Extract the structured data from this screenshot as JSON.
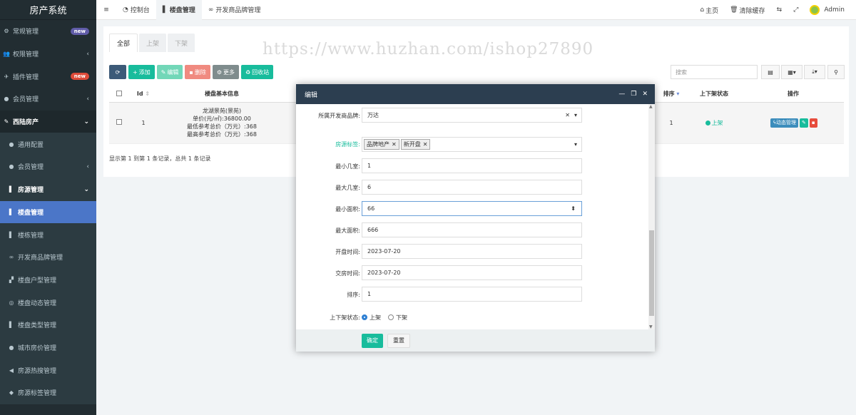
{
  "app": {
    "title": "房产系统"
  },
  "sidebar": {
    "items": [
      {
        "label": "常规管理",
        "badge": "new"
      },
      {
        "label": "权限管理"
      },
      {
        "label": "插件管理",
        "badge": "new"
      },
      {
        "label": "会员管理"
      },
      {
        "label": "西陆房产"
      },
      {
        "label": "通用配置"
      },
      {
        "label": "会员管理"
      },
      {
        "label": "房源管理"
      },
      {
        "label": "楼盘管理"
      },
      {
        "label": "楼栋管理"
      },
      {
        "label": "开发商品牌管理"
      },
      {
        "label": "楼盘户型管理"
      },
      {
        "label": "楼盘动态管理"
      },
      {
        "label": "楼盘类型管理"
      },
      {
        "label": "城市房价管理"
      },
      {
        "label": "房源热搜管理"
      },
      {
        "label": "房源标签管理"
      }
    ]
  },
  "topbar": {
    "tabs": [
      "控制台",
      "楼盘管理",
      "开发商品牌管理"
    ],
    "right": [
      "主页",
      "清除缓存",
      "Admin"
    ]
  },
  "status_tabs": [
    "全部",
    "上架",
    "下架"
  ],
  "toolbar": {
    "add": "添加",
    "edit": "编辑",
    "delete": "删除",
    "more": "更多",
    "recycle": "回收站",
    "search_placeholder": "搜索"
  },
  "table": {
    "headers": [
      "Id",
      "楼盘基本信息",
      "",
      "排序",
      "上下架状态",
      "操作"
    ],
    "rows": [
      {
        "id": "1",
        "info": [
          "龙湖景苑(景苑)",
          "单价(元/㎡):36800.00",
          "最低参考总价（万元）:368",
          "最高参考总价（万元）:368"
        ],
        "sort": "1",
        "status": "上架",
        "dynamic": "动态管理"
      }
    ],
    "footer": "显示第 1 到第 1 条记录，总共 1 条记录"
  },
  "watermark": "https://www.huzhan.com/ishop27890",
  "modal": {
    "title": "编辑",
    "fields": [
      {
        "label": "所属开发商品牌:",
        "value": "万达"
      },
      {
        "label": "房源标签:",
        "tags": [
          "品牌地产",
          "新开盘"
        ]
      },
      {
        "label": "最小几室:",
        "value": "1"
      },
      {
        "label": "最大几室:",
        "value": "6"
      },
      {
        "label": "最小面积:",
        "value": "66"
      },
      {
        "label": "最大面积:",
        "value": "666"
      },
      {
        "label": "开盘时间:",
        "value": "2023-07-20"
      },
      {
        "label": "交房时间:",
        "value": "2023-07-20"
      },
      {
        "label": "排序:",
        "value": "1"
      },
      {
        "label": "上下架状态:",
        "options": [
          "上架",
          "下架"
        ]
      }
    ],
    "confirm": "确定",
    "reset": "重置"
  }
}
